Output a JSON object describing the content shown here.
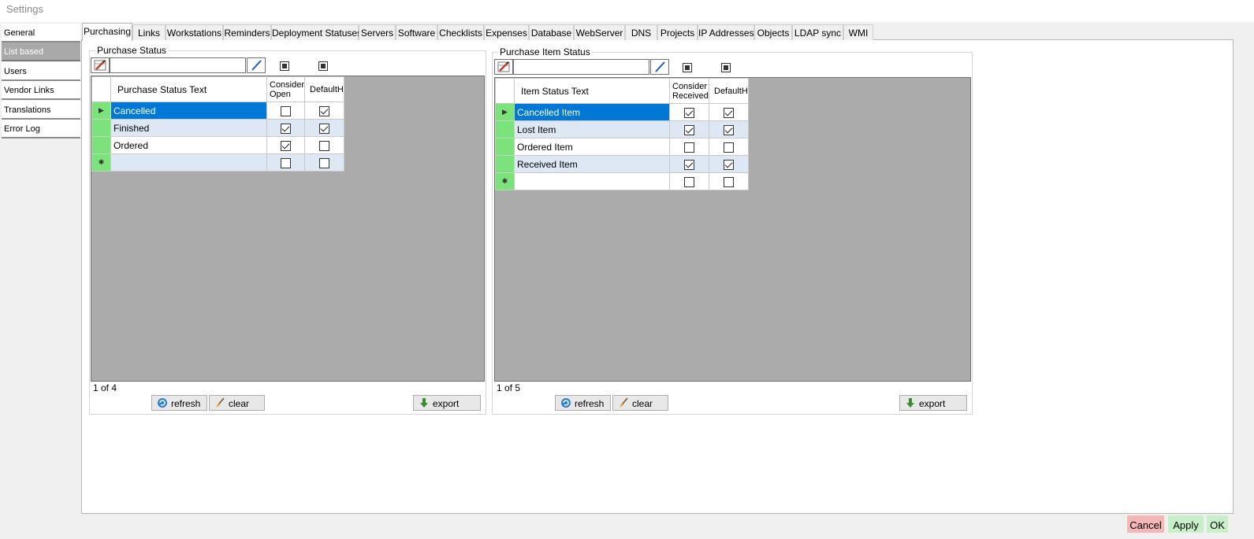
{
  "window": {
    "title": "Settings"
  },
  "leftnav": {
    "items": [
      {
        "label": "General",
        "active": false
      },
      {
        "label": "List based",
        "active": true
      },
      {
        "label": "Users",
        "active": false
      },
      {
        "label": "Vendor Links",
        "active": false
      },
      {
        "label": "Translations",
        "active": false
      },
      {
        "label": "Error Log",
        "active": false
      }
    ]
  },
  "tabs": [
    "Purchasing",
    "Links",
    "Workstations",
    "Reminders",
    "Deployment Statuses",
    "Servers",
    "Software",
    "Checklists",
    "Expenses",
    "Database",
    "WebServer",
    "DNS",
    "Projects",
    "IP Addresses",
    "Objects",
    "LDAP sync",
    "WMI"
  ],
  "active_tab": "Purchasing",
  "purchase_status": {
    "title": "Purchase Status",
    "search_value": "",
    "columns": {
      "text": "Purchase Status Text",
      "flag1": "Consider Open",
      "flag2": "DefaultH"
    },
    "rows": [
      {
        "text": "Cancelled",
        "flag1": false,
        "flag2": true
      },
      {
        "text": "Finished",
        "flag1": true,
        "flag2": true
      },
      {
        "text": "Ordered",
        "flag1": true,
        "flag2": false
      },
      {
        "text": "",
        "flag1": false,
        "flag2": false
      }
    ],
    "pager": "1 of 4",
    "refresh_label": "refresh",
    "clear_label": "clear",
    "export_label": "export"
  },
  "purchase_item_status": {
    "title": "Purchase Item Status",
    "search_value": "",
    "columns": {
      "text": "Item Status Text",
      "flag1": "Consider Received",
      "flag2": "DefaultH"
    },
    "rows": [
      {
        "text": "Cancelled Item",
        "flag1": true,
        "flag2": true
      },
      {
        "text": "Lost Item",
        "flag1": true,
        "flag2": true
      },
      {
        "text": "Ordered Item",
        "flag1": false,
        "flag2": false
      },
      {
        "text": "Received Item",
        "flag1": true,
        "flag2": true
      },
      {
        "text": "",
        "flag1": false,
        "flag2": false
      }
    ],
    "pager": "1 of 5",
    "refresh_label": "refresh",
    "clear_label": "clear",
    "export_label": "export"
  },
  "footer": {
    "cancel_label": "Cancel",
    "apply_label": "Apply",
    "ok_label": "OK"
  },
  "colors": {
    "selection": "#0078d7",
    "row_header": "#7ce37c",
    "alt_row": "#dde8f4",
    "cancel_bg": "#f4b6b6",
    "apply_bg": "#c8f0c8",
    "ok_bg": "#c8f0c8"
  }
}
